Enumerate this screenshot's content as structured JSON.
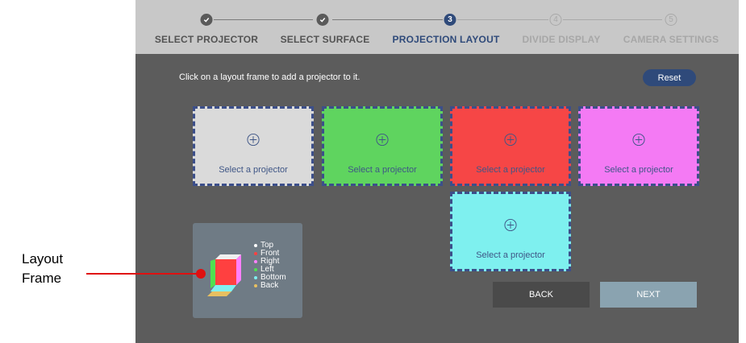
{
  "stepper": {
    "steps": [
      {
        "label": "SELECT PROJECTOR",
        "state": "done",
        "icon": "check-icon"
      },
      {
        "label": "SELECT SURFACE",
        "state": "done",
        "icon": "check-icon"
      },
      {
        "label": "PROJECTION LAYOUT",
        "state": "active",
        "number": "3"
      },
      {
        "label": "DIVIDE DISPLAY",
        "state": "future",
        "number": "4"
      },
      {
        "label": "CAMERA SETTINGS",
        "state": "future",
        "number": "5"
      }
    ]
  },
  "instruction": "Click on a layout frame to add a projector to it.",
  "reset_label": "Reset",
  "frames": [
    {
      "label": "Select a projector",
      "color": "#dadada"
    },
    {
      "label": "Select a projector",
      "color": "#5fd45f"
    },
    {
      "label": "Select a projector",
      "color": "#f64646"
    },
    {
      "label": "Select a projector",
      "color": "#f47af4"
    },
    {
      "label": "Select a projector",
      "color": "#7ef0ef"
    }
  ],
  "legend": {
    "items": [
      {
        "label": "Top",
        "color": "#ffffff"
      },
      {
        "label": "Front",
        "color": "#ff4040"
      },
      {
        "label": "Right",
        "color": "#ff80ff"
      },
      {
        "label": "Left",
        "color": "#50e050"
      },
      {
        "label": "Bottom",
        "color": "#80f0f0"
      },
      {
        "label": "Back",
        "color": "#e8c060"
      }
    ]
  },
  "buttons": {
    "back": "BACK",
    "next": "NEXT"
  },
  "annotation": {
    "line1": "Layout",
    "line2": "Frame"
  },
  "colors": {
    "accent": "#2f4a7a",
    "annotation": "#e01010",
    "back_button": "#4a4a4a",
    "next_button": "#8aa3b0"
  }
}
